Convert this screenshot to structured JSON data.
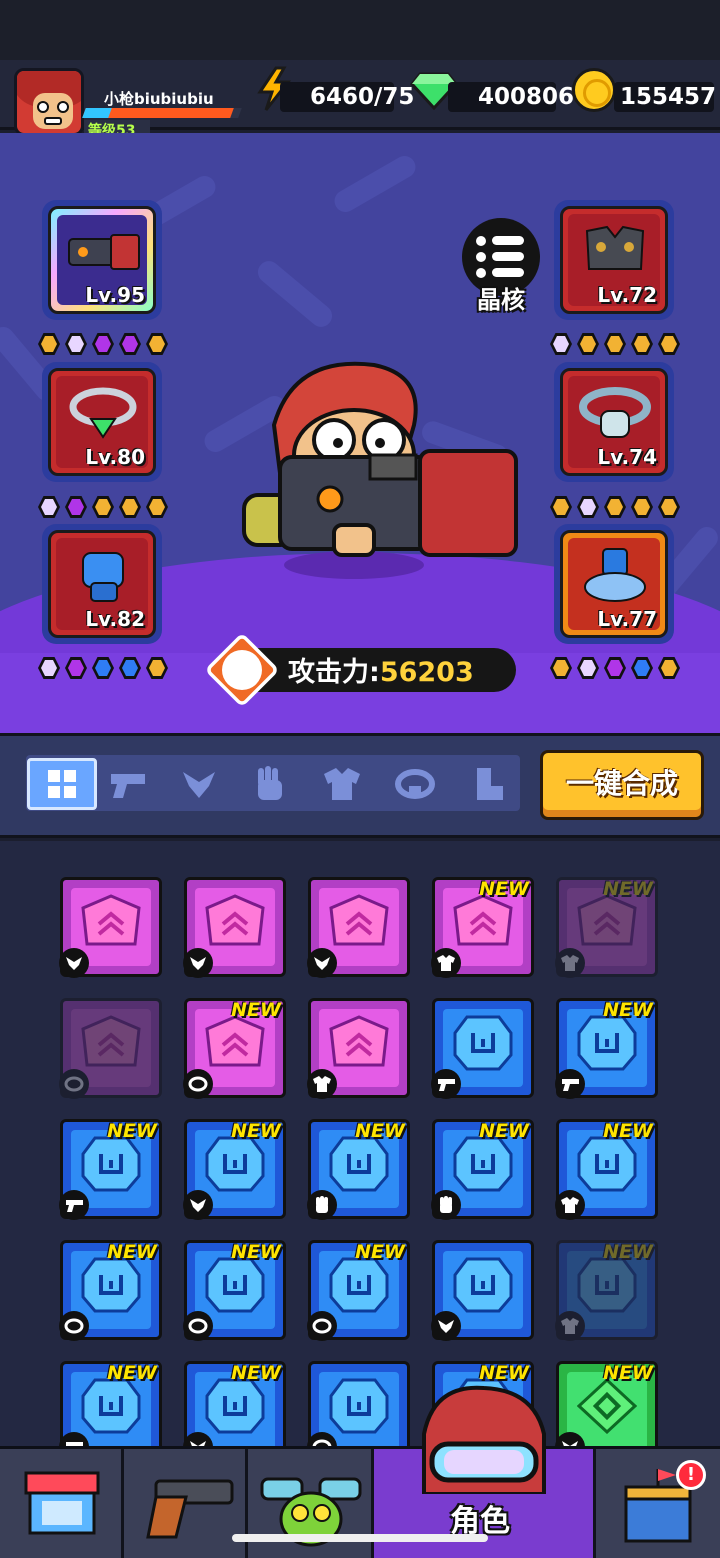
{
  "player": {
    "name": "小枪biubiubiu",
    "level": "等级53",
    "xp_fraction": 0.95
  },
  "resources": {
    "energy": "6460/75",
    "gems": "400806",
    "coins": "155457"
  },
  "equipment": {
    "left": [
      {
        "level": "Lv.95",
        "gems": [
          "#f2b233",
          "#e8d6ff",
          "#b035e8",
          "#b035e8",
          "#f2b233"
        ]
      },
      {
        "level": "Lv.80",
        "gems": [
          "#e8d6ff",
          "#b035e8",
          "#f2b233",
          "#f2b233",
          "#f2b233"
        ]
      },
      {
        "level": "Lv.82",
        "gems": [
          "#e8d6ff",
          "#b035e8",
          "#2f7cf5",
          "#2f7cf5",
          "#f2b233"
        ]
      }
    ],
    "right": [
      {
        "level": "Lv.72",
        "gems": [
          "#e8d6ff",
          "#f2b233",
          "#f2b233",
          "#f2b233",
          "#f2b233"
        ]
      },
      {
        "level": "Lv.74",
        "gems": [
          "#f2b233",
          "#e8d6ff",
          "#f2b233",
          "#f2b233",
          "#f2b233"
        ]
      },
      {
        "level": "Lv.77",
        "gems": [
          "#f2b233",
          "#e8d6ff",
          "#b035e8",
          "#2f7cf5",
          "#f2b233"
        ]
      }
    ],
    "core_label": "晶核",
    "attack_label": "攻击力:",
    "attack_value": "56203"
  },
  "filters": {
    "tabs": [
      "all-icon",
      "gun-icon",
      "necklace-icon",
      "glove-icon",
      "armor-icon",
      "belt-icon",
      "boot-icon"
    ],
    "merge_label": "一键合成"
  },
  "inventory": {
    "new_label": "NEW",
    "items": [
      {
        "color": "purple",
        "new": false,
        "dim": false,
        "type": "necklace"
      },
      {
        "color": "purple",
        "new": false,
        "dim": false,
        "type": "necklace"
      },
      {
        "color": "purple",
        "new": false,
        "dim": false,
        "type": "necklace"
      },
      {
        "color": "purple",
        "new": true,
        "dim": false,
        "type": "armor"
      },
      {
        "color": "purple",
        "new": true,
        "dim": true,
        "type": "armor"
      },
      {
        "color": "purple",
        "new": false,
        "dim": true,
        "type": "belt"
      },
      {
        "color": "purple",
        "new": true,
        "dim": false,
        "type": "belt"
      },
      {
        "color": "purple",
        "new": false,
        "dim": false,
        "type": "armor"
      },
      {
        "color": "blue",
        "new": false,
        "dim": false,
        "type": "gun"
      },
      {
        "color": "blue",
        "new": true,
        "dim": false,
        "type": "gun"
      },
      {
        "color": "blue",
        "new": true,
        "dim": false,
        "type": "gun"
      },
      {
        "color": "blue",
        "new": true,
        "dim": false,
        "type": "necklace"
      },
      {
        "color": "blue",
        "new": true,
        "dim": false,
        "type": "glove"
      },
      {
        "color": "blue",
        "new": true,
        "dim": false,
        "type": "glove"
      },
      {
        "color": "blue",
        "new": true,
        "dim": false,
        "type": "armor"
      },
      {
        "color": "blue",
        "new": true,
        "dim": false,
        "type": "belt"
      },
      {
        "color": "blue",
        "new": true,
        "dim": false,
        "type": "belt"
      },
      {
        "color": "blue",
        "new": true,
        "dim": false,
        "type": "belt"
      },
      {
        "color": "blue",
        "new": false,
        "dim": false,
        "type": "necklace"
      },
      {
        "color": "blue",
        "new": true,
        "dim": true,
        "type": "armor"
      },
      {
        "color": "blue",
        "new": true,
        "dim": false,
        "type": "gun"
      },
      {
        "color": "blue",
        "new": true,
        "dim": false,
        "type": "necklace"
      },
      {
        "color": "blue",
        "new": false,
        "dim": false,
        "type": "belt"
      },
      {
        "color": "blue",
        "new": true,
        "dim": false,
        "type": "necklace"
      },
      {
        "color": "green",
        "new": true,
        "dim": false,
        "type": "necklace"
      }
    ]
  },
  "nav": {
    "items": [
      "shop-icon",
      "weapon-icon",
      "pet-icon",
      "character-icon",
      "castle-icon"
    ],
    "active_label": "角色",
    "alert": "!"
  },
  "colors": {
    "accent": "#ffc22c",
    "attack": "#ffd23c",
    "xp": "#ff5a1e"
  }
}
